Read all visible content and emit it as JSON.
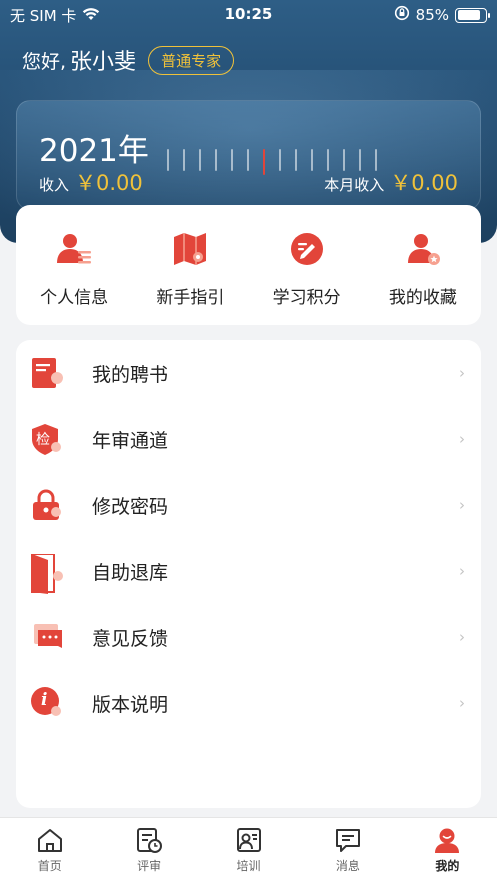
{
  "status_bar": {
    "carrier": "无 SIM 卡",
    "time": "10:25",
    "battery": "85%",
    "battery_level": 0.85
  },
  "header": {
    "greeting": "您好,",
    "name": "张小斐",
    "badge": "普通专家"
  },
  "income": {
    "year": "2021年",
    "total_label": "收入",
    "total_value": "￥0.00",
    "month_label": "本月收入",
    "month_value": "￥0.00"
  },
  "quick_actions": [
    {
      "label": "个人信息",
      "icon": "user-info-icon"
    },
    {
      "label": "新手指引",
      "icon": "map-guide-icon"
    },
    {
      "label": "学习积分",
      "icon": "study-points-icon"
    },
    {
      "label": "我的收藏",
      "icon": "favorites-icon"
    }
  ],
  "menu": [
    {
      "label": "我的聘书",
      "icon": "certificate-icon"
    },
    {
      "label": "年审通道",
      "icon": "annual-review-icon",
      "icon_text": "检"
    },
    {
      "label": "修改密码",
      "icon": "lock-icon"
    },
    {
      "label": "自助退库",
      "icon": "exit-door-icon"
    },
    {
      "label": "意见反馈",
      "icon": "feedback-icon"
    },
    {
      "label": "版本说明",
      "icon": "info-icon",
      "icon_text": "i"
    }
  ],
  "tabs": [
    {
      "label": "首页",
      "icon": "home-icon"
    },
    {
      "label": "评审",
      "icon": "review-icon"
    },
    {
      "label": "培训",
      "icon": "training-icon"
    },
    {
      "label": "消息",
      "icon": "message-icon"
    },
    {
      "label": "我的",
      "icon": "profile-icon",
      "active": true
    }
  ],
  "colors": {
    "header": "#2a5678",
    "accent_gold": "#f0c23a",
    "brand_red": "#e2453a"
  }
}
